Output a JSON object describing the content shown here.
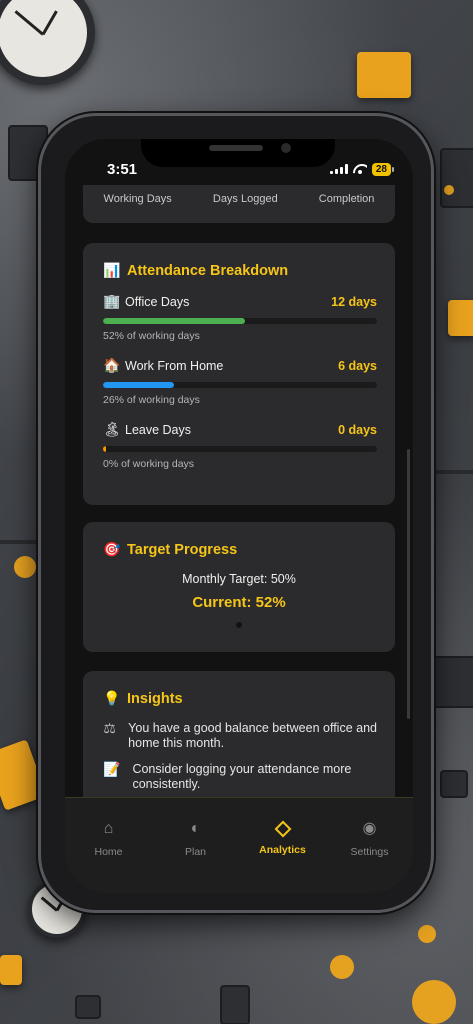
{
  "status": {
    "time": "3:51",
    "battery": "28"
  },
  "summary": {
    "labels": [
      "Working Days",
      "Days Logged",
      "Completion"
    ]
  },
  "breakdown": {
    "title": "Attendance Breakdown",
    "icon": "bar-chart-icon",
    "rows": [
      {
        "icon": "office-building-icon",
        "glyph": "🏢",
        "label": "Office Days",
        "value": "12 days",
        "percent": 52,
        "sub": "52% of working days",
        "color": "#4caf50"
      },
      {
        "icon": "house-icon",
        "glyph": "🏠",
        "label": "Work From Home",
        "value": "6 days",
        "percent": 26,
        "sub": "26% of working days",
        "color": "#2196f3"
      },
      {
        "icon": "beach-icon",
        "glyph": "🏝",
        "label": "Leave Days",
        "value": "0 days",
        "percent": 0,
        "sub": "0% of working days",
        "color": "#ff9800"
      }
    ]
  },
  "target": {
    "title": "Target Progress",
    "icon": "target-icon",
    "monthly": "Monthly Target: 50%",
    "current": "Current: 52%"
  },
  "insights": {
    "title": "Insights",
    "icon": "lightbulb-icon",
    "items": [
      {
        "icon": "balance-scale-icon",
        "glyph": "⚖",
        "text": "You have a good balance between office and home this month."
      },
      {
        "icon": "memo-icon",
        "glyph": "📝",
        "text": "Consider logging your attendance more consistently."
      }
    ]
  },
  "tabs": [
    {
      "name": "home",
      "label": "Home",
      "glyph": "⌂",
      "active": false
    },
    {
      "name": "plan",
      "label": "Plan",
      "glyph": "◐",
      "active": false
    },
    {
      "name": "analytics",
      "label": "Analytics",
      "glyph": "",
      "active": true
    },
    {
      "name": "settings",
      "label": "Settings",
      "glyph": "◉",
      "active": false
    }
  ],
  "colors": {
    "accent": "#f5c518",
    "office": "#4caf50",
    "wfh": "#2196f3",
    "leave": "#ff9800"
  }
}
